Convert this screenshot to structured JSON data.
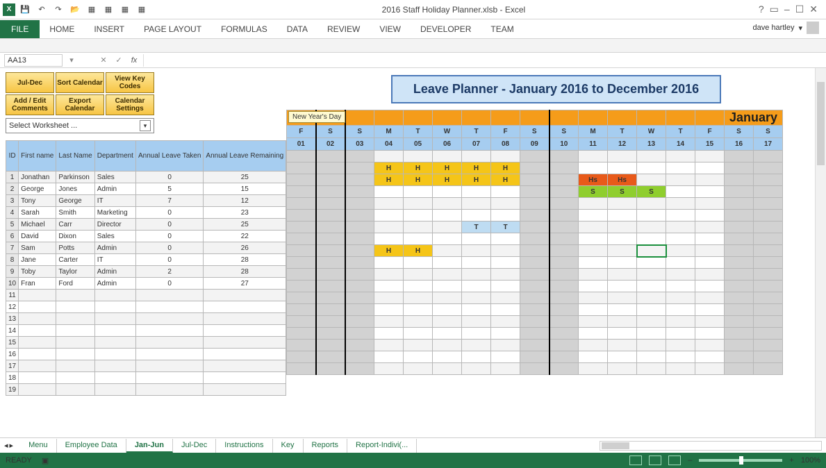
{
  "qat": {
    "title": "2016 Staff Holiday Planner.xlsb - Excel"
  },
  "ribbon": {
    "file": "FILE",
    "tabs": [
      "HOME",
      "INSERT",
      "PAGE LAYOUT",
      "FORMULAS",
      "DATA",
      "REVIEW",
      "VIEW",
      "DEVELOPER",
      "TEAM"
    ],
    "user": "dave hartley"
  },
  "formula": {
    "name_box": "AA13"
  },
  "buttons": {
    "b1": "Jul-Dec",
    "b2": "Sort Calendar",
    "b3": "View Key Codes",
    "b4": "Add / Edit Comments",
    "b5": "Export Calendar",
    "b6": "Calendar Settings"
  },
  "ws_select": "Select Worksheet ...",
  "staff_headers": {
    "id": "ID",
    "fn": "First name",
    "ln": "Last Name",
    "dept": "Department",
    "alt": "Annual Leave Taken",
    "alr": "Annual Leave Remaining"
  },
  "staff": [
    {
      "id": "1",
      "fn": "Jonathan",
      "ln": "Parkinson",
      "dept": "Sales",
      "alt": "0",
      "alr": "25"
    },
    {
      "id": "2",
      "fn": "George",
      "ln": "Jones",
      "dept": "Admin",
      "alt": "5",
      "alr": "15"
    },
    {
      "id": "3",
      "fn": "Tony",
      "ln": "George",
      "dept": "IT",
      "alt": "7",
      "alr": "12"
    },
    {
      "id": "4",
      "fn": "Sarah",
      "ln": "Smith",
      "dept": "Marketing",
      "alt": "0",
      "alr": "23"
    },
    {
      "id": "5",
      "fn": "Michael",
      "ln": "Carr",
      "dept": "Director",
      "alt": "0",
      "alr": "25"
    },
    {
      "id": "6",
      "fn": "David",
      "ln": "Dixon",
      "dept": "Sales",
      "alt": "0",
      "alr": "22"
    },
    {
      "id": "7",
      "fn": "Sam",
      "ln": "Potts",
      "dept": "Admin",
      "alt": "0",
      "alr": "26"
    },
    {
      "id": "8",
      "fn": "Jane",
      "ln": "Carter",
      "dept": "IT",
      "alt": "0",
      "alr": "28"
    },
    {
      "id": "9",
      "fn": "Toby",
      "ln": "Taylor",
      "dept": "Admin",
      "alt": "2",
      "alr": "28"
    },
    {
      "id": "10",
      "fn": "Fran",
      "ln": "Ford",
      "dept": "Admin",
      "alt": "0",
      "alr": "27"
    }
  ],
  "blank_rows": [
    "11",
    "12",
    "13",
    "14",
    "15",
    "16",
    "17",
    "18",
    "19"
  ],
  "planner_title": "Leave Planner - January 2016 to December 2016",
  "tooltip": "New Year's Day",
  "month": "January",
  "dows": [
    "F",
    "S",
    "S",
    "M",
    "T",
    "W",
    "T",
    "F",
    "S",
    "S",
    "M",
    "T",
    "W",
    "T",
    "F",
    "S",
    "S"
  ],
  "dnums": [
    "01",
    "02",
    "03",
    "04",
    "05",
    "06",
    "07",
    "08",
    "09",
    "10",
    "11",
    "12",
    "13",
    "14",
    "15",
    "16",
    "17"
  ],
  "weekend_cols": [
    0,
    1,
    2,
    8,
    9,
    15,
    16
  ],
  "cal_rows": [
    {
      "cells": {}
    },
    {
      "cells": {
        "3": "H",
        "4": "H",
        "5": "H",
        "6": "H",
        "7": "H"
      }
    },
    {
      "cells": {
        "3": "H",
        "4": "H",
        "5": "H",
        "6": "H",
        "7": "H",
        "10": "Hs",
        "11": "Hs"
      }
    },
    {
      "cells": {
        "10": "S",
        "11": "S",
        "12": "S"
      }
    },
    {
      "cells": {}
    },
    {
      "cells": {}
    },
    {
      "cells": {
        "6": "T",
        "7": "T"
      }
    },
    {
      "cells": {}
    },
    {
      "cells": {
        "3": "H",
        "4": "H"
      },
      "sel": 12
    },
    {
      "cells": {}
    }
  ],
  "cal_blank_rows": 9,
  "sheet_tabs": [
    "Menu",
    "Employee Data",
    "Jan-Jun",
    "Jul-Dec",
    "Instructions",
    "Key",
    "Reports",
    "Report-Indivi(..."
  ],
  "active_tab": "Jan-Jun",
  "status": {
    "ready": "READY",
    "zoom": "100%"
  }
}
